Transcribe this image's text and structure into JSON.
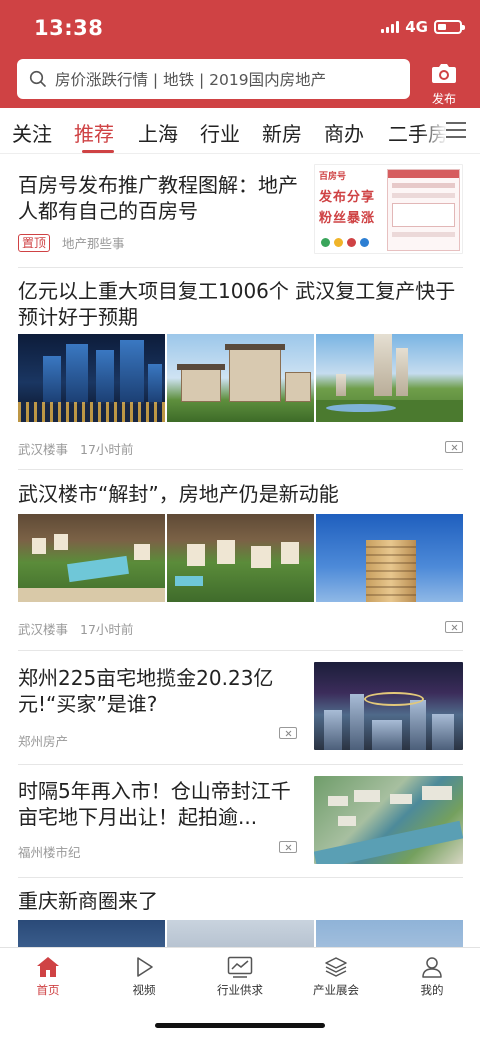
{
  "status_bar": {
    "time": "13:38",
    "network": "4G"
  },
  "search": {
    "placeholder": "房价涨跌行情 | 地铁 | 2019国内房地产"
  },
  "publish": {
    "label": "发布"
  },
  "tabs": [
    {
      "label": "关注",
      "active": false
    },
    {
      "label": "推荐",
      "active": true
    },
    {
      "label": "上海",
      "active": false
    },
    {
      "label": "行业",
      "active": false
    },
    {
      "label": "新房",
      "active": false
    },
    {
      "label": "商办",
      "active": false
    },
    {
      "label": "二手房",
      "active": false
    }
  ],
  "feed": [
    {
      "title": "百房号发布推广教程图解：地产人都有自己的百房号",
      "badge": "置顶",
      "source": "地产那些事",
      "promo": {
        "logo": "百房号",
        "headline_line1": "发布分享",
        "headline_line2": "粉丝暴涨"
      }
    },
    {
      "title": "亿元以上重大项目复工1006个 武汉复工复产快于预计好于预期",
      "source": "武汉楼事",
      "time": "17小时前"
    },
    {
      "title": "武汉楼市“解封”，房地产仍是新动能",
      "source": "武汉楼事",
      "time": "17小时前"
    },
    {
      "title": "郑州225亩宅地揽金20.23亿元!“买家”是谁?",
      "source": "郑州房产"
    },
    {
      "title": "时隔5年再入市！仓山帝封江千亩宅地下月出让！起拍逾...",
      "source": "福州楼市纪"
    },
    {
      "title": "重庆新商圈来了"
    }
  ],
  "bottom_nav": [
    {
      "label": "首页",
      "icon": "home-icon",
      "active": true
    },
    {
      "label": "视频",
      "icon": "play-icon",
      "active": false
    },
    {
      "label": "行业供求",
      "icon": "chart-icon",
      "active": false
    },
    {
      "label": "产业展会",
      "icon": "layers-icon",
      "active": false
    },
    {
      "label": "我的",
      "icon": "user-icon",
      "active": false
    }
  ],
  "colors": {
    "accent": "#cf4244",
    "meta_text": "#999999"
  }
}
